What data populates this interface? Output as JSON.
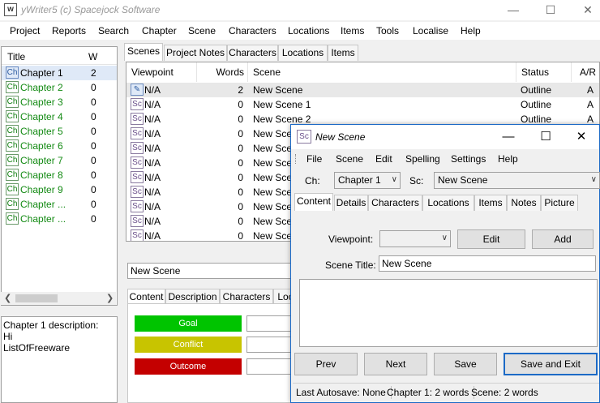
{
  "app": {
    "title": "yWriter5 (c) Spacejock Software",
    "icon_glyph": "w"
  },
  "menu": [
    "Project",
    "Reports",
    "Search",
    "Chapter",
    "Scene",
    "Characters",
    "Locations",
    "Items",
    "Tools",
    "Localise",
    "Help"
  ],
  "chapters": {
    "headers": {
      "title": "Title",
      "words": "W"
    },
    "rows": [
      {
        "name": "Chapter 1",
        "words": "2"
      },
      {
        "name": "Chapter 2",
        "words": "0"
      },
      {
        "name": "Chapter 3",
        "words": "0"
      },
      {
        "name": "Chapter 4",
        "words": "0"
      },
      {
        "name": "Chapter 5",
        "words": "0"
      },
      {
        "name": "Chapter 6",
        "words": "0"
      },
      {
        "name": "Chapter 7",
        "words": "0"
      },
      {
        "name": "Chapter 8",
        "words": "0"
      },
      {
        "name": "Chapter 9",
        "words": "0"
      },
      {
        "name": "Chapter ...",
        "words": "0"
      },
      {
        "name": "Chapter ...",
        "words": "0"
      }
    ],
    "chip_label": "Ch",
    "description_lines": [
      "Chapter 1 description:",
      "Hi",
      "ListOfFreeware"
    ]
  },
  "main_tabs": [
    "Scenes",
    "Project Notes",
    "Characters",
    "Locations",
    "Items"
  ],
  "scene_grid": {
    "headers": {
      "viewpoint": "Viewpoint",
      "words": "Words",
      "scene": "Scene",
      "status": "Status",
      "ar": "A/R"
    },
    "chip_label": "Sc",
    "rows": [
      {
        "viewpoint": "N/A",
        "words": "2",
        "scene": "New Scene",
        "status": "Outline",
        "ar": "A"
      },
      {
        "viewpoint": "N/A",
        "words": "0",
        "scene": "New Scene 1",
        "status": "Outline",
        "ar": "A"
      },
      {
        "viewpoint": "N/A",
        "words": "0",
        "scene": "New Scene 2",
        "status": "Outline",
        "ar": "A"
      },
      {
        "viewpoint": "N/A",
        "words": "0",
        "scene": "New Sce",
        "status": "",
        "ar": ""
      },
      {
        "viewpoint": "N/A",
        "words": "0",
        "scene": "New Sce",
        "status": "",
        "ar": ""
      },
      {
        "viewpoint": "N/A",
        "words": "0",
        "scene": "New Sce",
        "status": "",
        "ar": ""
      },
      {
        "viewpoint": "N/A",
        "words": "0",
        "scene": "New Sce",
        "status": "",
        "ar": ""
      },
      {
        "viewpoint": "N/A",
        "words": "0",
        "scene": "New Sce",
        "status": "",
        "ar": ""
      },
      {
        "viewpoint": "N/A",
        "words": "0",
        "scene": "New Sce",
        "status": "",
        "ar": ""
      },
      {
        "viewpoint": "N/A",
        "words": "0",
        "scene": "New Sce",
        "status": "",
        "ar": ""
      },
      {
        "viewpoint": "N/A",
        "words": "0",
        "scene": "New Sce",
        "status": "",
        "ar": ""
      }
    ]
  },
  "selected_scene_title": "New Scene",
  "bottom_tabs": [
    "Content",
    "Description",
    "Characters",
    "Loc"
  ],
  "gco": [
    {
      "label": "Goal",
      "color": "#00c400"
    },
    {
      "label": "Conflict",
      "color": "#c8c400"
    },
    {
      "label": "Outcome",
      "color": "#c40000"
    }
  ],
  "dialog": {
    "title": "New Scene",
    "icon": "Sc",
    "menu": [
      "File",
      "Scene",
      "Edit",
      "Spelling",
      "Settings",
      "Help"
    ],
    "ch_label": "Ch:",
    "ch_value": "Chapter 1",
    "sc_label": "Sc:",
    "sc_value": "New Scene",
    "tabs": [
      "Content",
      "Details",
      "Characters",
      "Locations",
      "Items",
      "Notes",
      "Picture"
    ],
    "viewpoint_label": "Viewpoint:",
    "viewpoint_value": "",
    "edit_button": "Edit",
    "add_button": "Add",
    "scene_title_label": "Scene Title:",
    "scene_title_value": "New Scene",
    "buttons": {
      "prev": "Prev",
      "next": "Next",
      "save": "Save",
      "save_exit": "Save and Exit"
    },
    "status": {
      "autosave": "Last Autosave: None",
      "chapter": "Chapter 1: 2 words",
      "scene": "Scene: 2 words"
    }
  }
}
